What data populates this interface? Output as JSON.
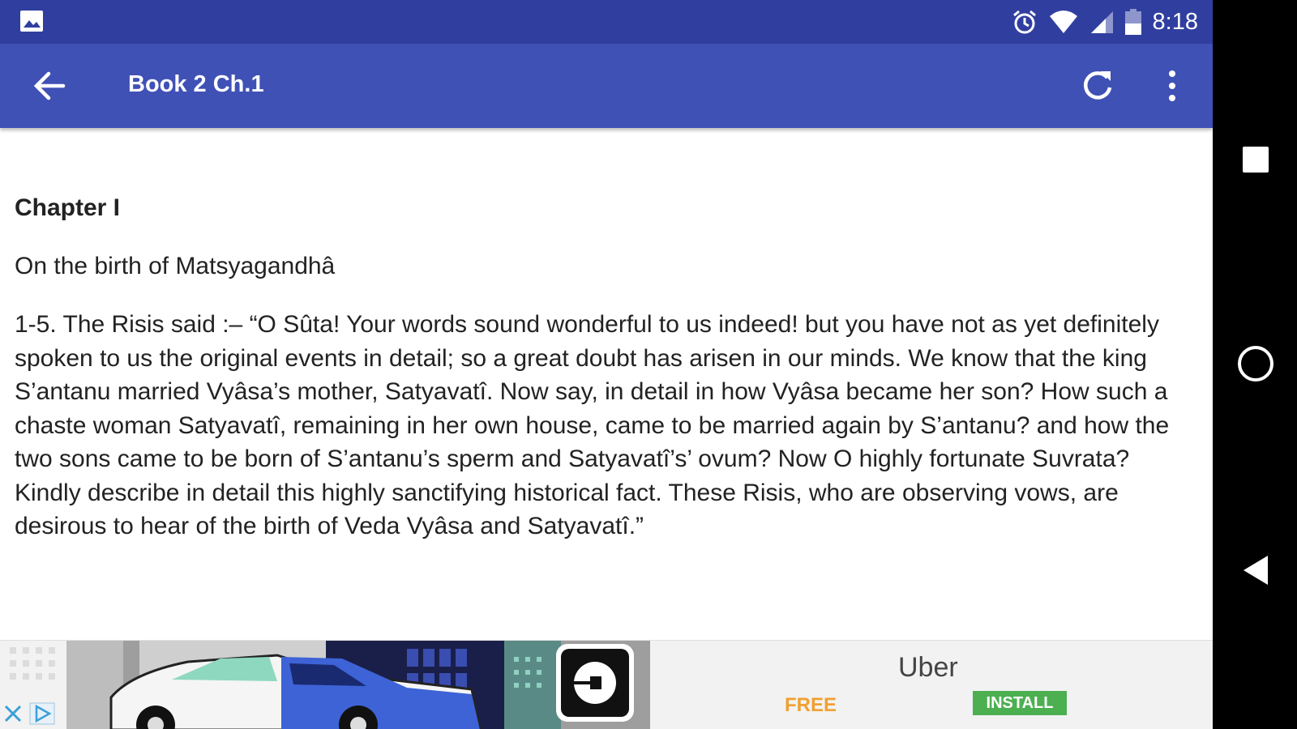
{
  "status_bar": {
    "time": "8:18",
    "icons": [
      "image-icon",
      "alarm-icon",
      "wifi-icon",
      "cell-signal-icon",
      "battery-icon"
    ]
  },
  "app_bar": {
    "title": "Book 2 Ch.1",
    "icons": [
      "back-arrow-icon",
      "refresh-icon",
      "more-vert-icon"
    ]
  },
  "content": {
    "chapter": "Chapter I",
    "subtitle": "On the birth of Matsyagandhâ",
    "body": "1-5. The Risis said :– “O Sûta! Your words sound wonderful to us indeed! but you have not as yet definitely spoken to us the original events in detail; so a great doubt has arisen in our minds. We know that the king S’antanu married Vyâsa’s mother, Satyavatî. Now say, in detail in how Vyâsa became her son? How such a chaste woman Satyavatî, remaining in her own house, came to be married again by S’antanu? and how the two sons came to be born of S’antanu’s sperm and Satyavatî’s’ ovum? Now O highly fortunate Suvrata? Kindly describe in detail this highly sanctifying historical fact. These Risis, who are observing vows, are desirous to hear of the birth of Veda Vyâsa and Satyavatî.”"
  },
  "ad": {
    "app_name": "Uber",
    "price": "FREE",
    "install_label": "INSTALL",
    "colors": {
      "price": "#f0a030",
      "install_bg": "#4caf50"
    }
  },
  "nav_bar": {
    "icons": [
      "recent-apps-icon",
      "home-icon",
      "back-icon"
    ]
  },
  "colors": {
    "status_bar": "#303f9f",
    "app_bar": "#3f51b5",
    "background": "#ffffff",
    "text": "#222222"
  }
}
